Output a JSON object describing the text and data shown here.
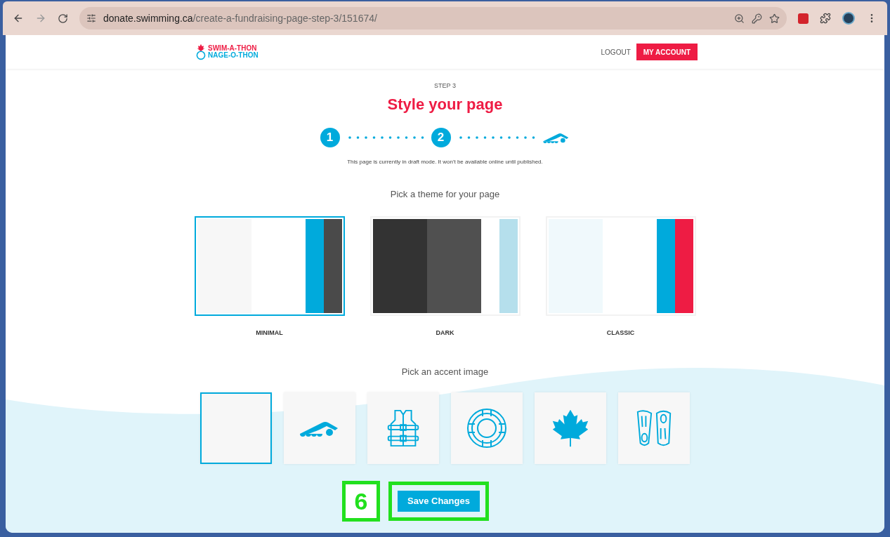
{
  "browser": {
    "url_host": "donate.swimming.ca",
    "url_path": "/create-a-fundraising-page-step-3/151674/"
  },
  "header": {
    "logo": [
      "SWIM-A-THON",
      "NAGE-O-THON"
    ],
    "logout": "LOGOUT",
    "account": "MY ACCOUNT"
  },
  "step_label": "STEP 3",
  "title": "Style your page",
  "steps": [
    {
      "kind": "number",
      "label": "1"
    },
    {
      "kind": "number",
      "label": "2"
    },
    {
      "kind": "icon"
    }
  ],
  "notice": "This page is currently in draft mode. It won't be available online until published.",
  "themes_heading": "Pick a theme for your page",
  "themes": [
    {
      "name": "MINIMAL",
      "selected": true,
      "swatches": [
        {
          "color": "#f7f7f7"
        },
        {
          "color": "#ffffff"
        },
        {
          "color": "#00aadc"
        },
        {
          "color": "#4a4a4a"
        }
      ]
    },
    {
      "name": "DARK",
      "selected": false,
      "swatches": [
        {
          "color": "#333333"
        },
        {
          "color": "#505050"
        },
        {
          "color": "#ffffff"
        },
        {
          "color": "#b5dfec"
        }
      ]
    },
    {
      "name": "CLASSIC",
      "selected": false,
      "swatches": [
        {
          "color": "#f0f9fc"
        },
        {
          "color": "#ffffff"
        },
        {
          "color": "#00aadc"
        },
        {
          "color": "#ee1c44"
        }
      ]
    }
  ],
  "accent_heading": "Pick an accent image",
  "accents": [
    {
      "kind": "none",
      "selected": true
    },
    {
      "kind": "swimmer",
      "selected": false
    },
    {
      "kind": "vest",
      "selected": false
    },
    {
      "kind": "ring",
      "selected": false
    },
    {
      "kind": "leaf",
      "selected": false
    },
    {
      "kind": "flippers",
      "selected": false
    }
  ],
  "save_button": "Save Changes",
  "annotation": {
    "label": "6",
    "highlight": true
  }
}
